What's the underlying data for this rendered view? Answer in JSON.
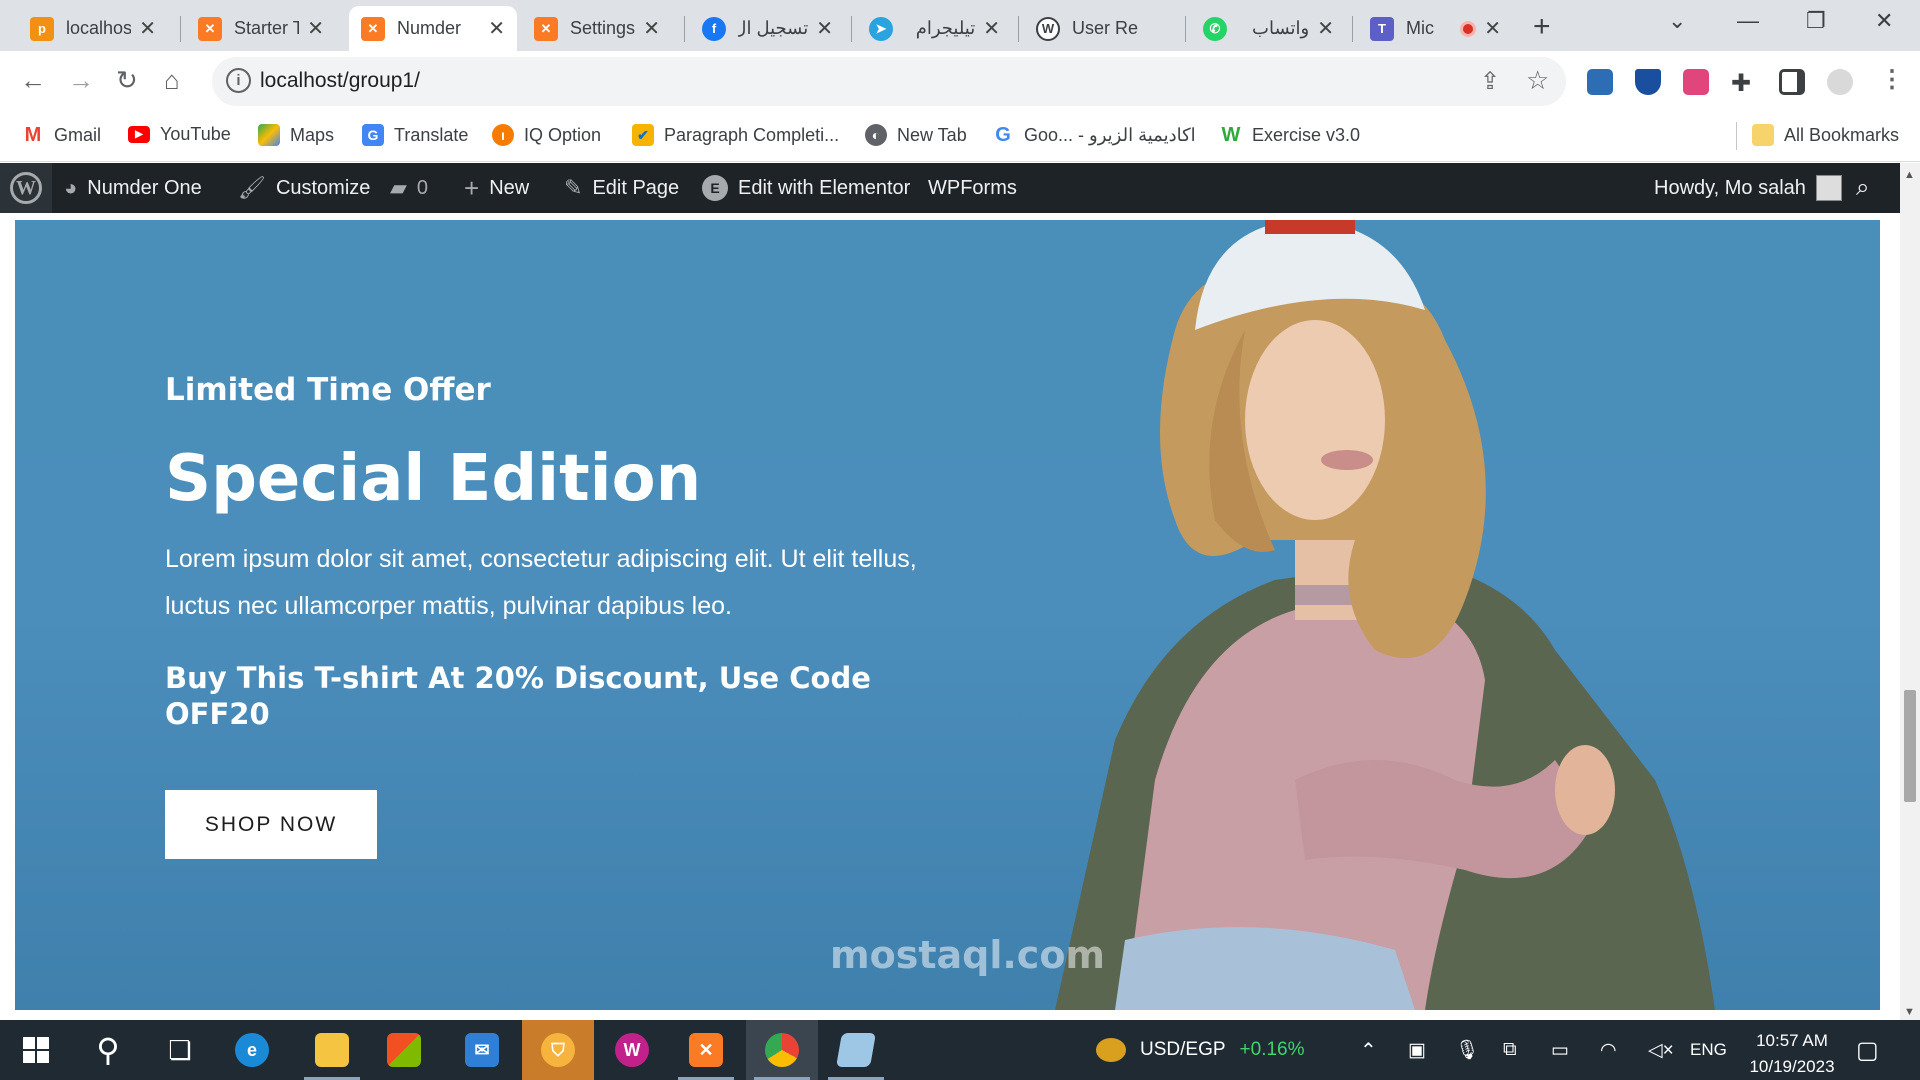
{
  "browser": {
    "tabs": [
      {
        "label": "localhos",
        "icon": "phpmyadmin-icon",
        "active": false
      },
      {
        "label": "Starter T",
        "icon": "xampp-icon",
        "active": false
      },
      {
        "label": "Numder",
        "icon": "xampp-icon",
        "active": true
      },
      {
        "label": "Settings",
        "icon": "xampp-icon",
        "active": false
      },
      {
        "label": "تسجيل ال",
        "icon": "facebook-icon",
        "active": false
      },
      {
        "label": "تيليجرام",
        "icon": "telegram-icon",
        "active": false
      },
      {
        "label": "User Re",
        "icon": "wordpress-icon",
        "active": false
      },
      {
        "label": "واتساب",
        "icon": "whatsapp-icon",
        "active": false
      },
      {
        "label": "Mic",
        "icon": "teams-icon",
        "active": false
      }
    ],
    "url": "localhost/group1/",
    "bookmarks": [
      {
        "label": "Gmail",
        "icon": "gmail-icon"
      },
      {
        "label": "YouTube",
        "icon": "youtube-icon"
      },
      {
        "label": "Maps",
        "icon": "maps-icon"
      },
      {
        "label": "Translate",
        "icon": "translate-icon"
      },
      {
        "label": "IQ Option",
        "icon": "iq-option-icon"
      },
      {
        "label": "Paragraph Completi...",
        "icon": "paragraph-icon"
      },
      {
        "label": "New Tab",
        "icon": "globe-icon"
      },
      {
        "label": "Goo... - اكاديمية الزيرو",
        "icon": "google-icon"
      },
      {
        "label": "Exercise v3.0",
        "icon": "exercise-icon"
      }
    ],
    "all_bookmarks": "All Bookmarks"
  },
  "adminbar": {
    "site": "Numder One",
    "customize": "Customize",
    "comments": "0",
    "new": "New",
    "edit_page": "Edit Page",
    "elementor": "Edit with Elementor",
    "wpforms": "WPForms",
    "howdy": "Howdy, Mo salah"
  },
  "hero": {
    "offer": "Limited Time Offer",
    "title": "Special Edition",
    "description": "Lorem ipsum dolor sit amet, consectetur adipiscing elit. Ut elit tellus, luctus nec ullamcorper mattis, pulvinar dapibus leo.",
    "promo": "Buy This T-shirt At 20% Discount, Use Code OFF20",
    "button": "SHOP NOW",
    "background_color": "#4a8fba"
  },
  "watermark": "mostaql.com",
  "taskbar": {
    "currency": "USD/EGP",
    "change": "+0.16%",
    "language": "ENG",
    "time": "10:57 AM",
    "date": "10/19/2023"
  }
}
